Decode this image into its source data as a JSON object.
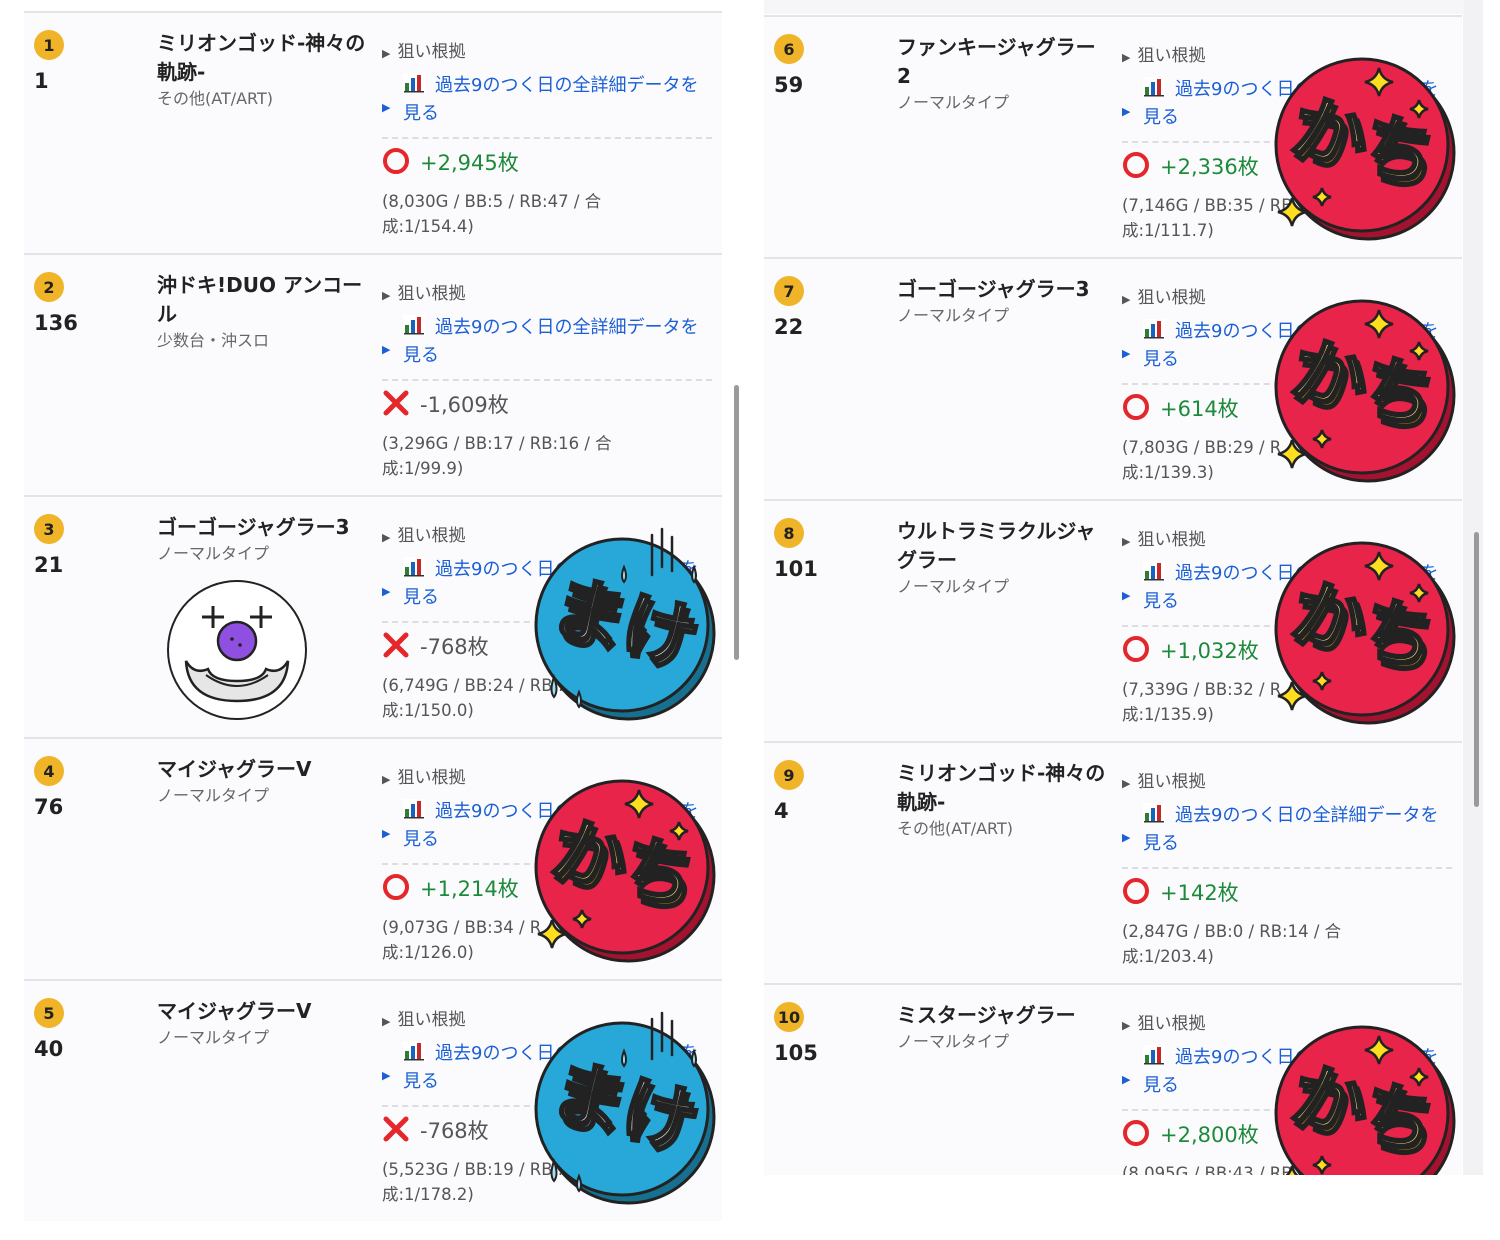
{
  "common": {
    "reason_label": "狙い根拠",
    "link_label": "過去9のつく日の全詳細データを見る"
  },
  "left": [
    {
      "rank": "1",
      "number": "1",
      "name": "ミリオンゴッド-神々の軌跡-",
      "type": "その他(AT/ART)",
      "result": "+2,945枚",
      "outcome": "win",
      "stats": "(8,030G / BB:5 / RB:47 / 合成:1/154.4)",
      "stamp": ""
    },
    {
      "rank": "2",
      "number": "136",
      "name": "沖ドキ!DUO アンコール",
      "type": "少数台・沖スロ",
      "result": "-1,609枚",
      "outcome": "lose",
      "stats": "(3,296G / BB:17 / RB:16 / 合成:1/99.9)",
      "stamp": ""
    },
    {
      "rank": "3",
      "number": "21",
      "name": "ゴーゴージャグラー3",
      "type": "ノーマルタイプ",
      "result": "-768枚",
      "outcome": "lose",
      "stats": "(6,749G / BB:24 / RB:... 成:1/150.0)",
      "stamp": "まけ",
      "clown": true
    },
    {
      "rank": "4",
      "number": "76",
      "name": "マイジャグラーV",
      "type": "ノーマルタイプ",
      "result": "+1,214枚",
      "outcome": "win",
      "stats": "(9,073G / BB:34 / R... 成:1/126.0)",
      "stamp": "かち"
    },
    {
      "rank": "5",
      "number": "40",
      "name": "マイジャグラーV",
      "type": "ノーマルタイプ",
      "result": "-768枚",
      "outcome": "lose",
      "stats": "(5,523G / BB:19 / RB... 成:1/178.2)",
      "stamp": "まけ"
    }
  ],
  "right": [
    {
      "rank": "6",
      "number": "59",
      "name": "ファンキージャグラー2",
      "type": "ノーマルタイプ",
      "result": "+2,336枚",
      "outcome": "win",
      "stats": "(7,146G / BB:35 / RB... 成:1/111.7)",
      "stamp": "かち"
    },
    {
      "rank": "7",
      "number": "22",
      "name": "ゴーゴージャグラー3",
      "type": "ノーマルタイプ",
      "result": "+614枚",
      "outcome": "win",
      "stats": "(7,803G / BB:29 / R... 成:1/139.3)",
      "stamp": "かち"
    },
    {
      "rank": "8",
      "number": "101",
      "name": "ウルトラミラクルジャグラー",
      "type": "ノーマルタイプ",
      "result": "+1,032枚",
      "outcome": "win",
      "stats": "(7,339G / BB:32 / R... 成:1/135.9)",
      "stamp": "かち"
    },
    {
      "rank": "9",
      "number": "4",
      "name": "ミリオンゴッド-神々の軌跡-",
      "type": "その他(AT/ART)",
      "result": "+142枚",
      "outcome": "win",
      "stats": "(2,847G / BB:0 / RB:14 / 合成:1/203.4)",
      "stamp": ""
    },
    {
      "rank": "10",
      "number": "105",
      "name": "ミスタージャグラー",
      "type": "ノーマルタイプ",
      "result": "+2,800枚",
      "outcome": "win",
      "stats": "(8,095G / BB:43 / RB...",
      "stamp": "かち"
    }
  ],
  "colors": {
    "badge": "#f0b429",
    "link": "#1a5fd6",
    "win": "#1d8a3a",
    "lose_mark": "#e5262b",
    "kachi": "#e8244a",
    "make": "#28a8d8",
    "sparkle": "#ffdd1f"
  },
  "icons": {
    "chart": "bar-chart-icon",
    "win": "circle-win-icon",
    "lose": "cross-lose-icon",
    "reason": "triangle-right-icon"
  }
}
